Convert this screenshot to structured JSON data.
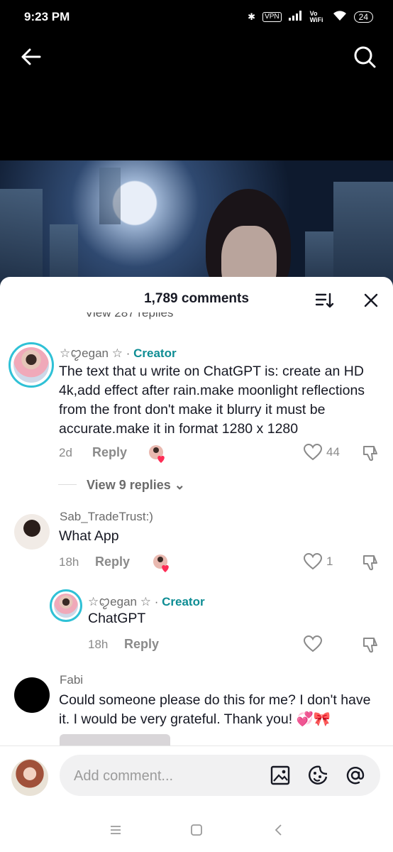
{
  "status": {
    "time": "9:23 PM",
    "vpn": "VPN",
    "wifi_label": "Vo WiFi",
    "battery": "24"
  },
  "colors": {
    "accent_teal": "#0e8d94",
    "creator_ring": "#2fc1d6",
    "text": "#161823",
    "muted": "#8a8a8a",
    "heart_red": "#fe2c55"
  },
  "header": {
    "comment_count": "1,789 comments",
    "peek_text": "View 287 replies"
  },
  "comments": [
    {
      "username": "☆ꨄegan ☆",
      "separator": "·",
      "tag": "Creator",
      "text": "The text that u write on ChatGPT is: create an HD 4k,add effect after rain.make moonlight reflections from the front don't make it blurry it must be accurate.make it in format 1280 x 1280",
      "age": "2d",
      "reply_label": "Reply",
      "likes": "44",
      "view_replies": "View 9 replies"
    },
    {
      "username": "Sab_TradeTrust:)",
      "text": "What App",
      "age": "18h",
      "reply_label": "Reply",
      "likes": "1"
    },
    {
      "username": "☆ꨄegan ☆",
      "separator": "·",
      "tag": "Creator",
      "text": "ChatGPT",
      "age": "18h",
      "reply_label": "Reply",
      "likes": ""
    },
    {
      "username": "Fabi",
      "text": "Could someone please do this for me? I don't have it. I would be very grateful. Thank you! 💞🎀"
    }
  ],
  "input": {
    "placeholder": "Add comment..."
  },
  "icons": {
    "back": "arrow-left-icon",
    "search": "search-icon",
    "sort": "sort-icon",
    "close": "close-icon",
    "heart": "heart-icon",
    "dislike": "thumb-down-icon",
    "image": "image-icon",
    "emoji": "emoji-icon",
    "mention": "at-icon"
  }
}
